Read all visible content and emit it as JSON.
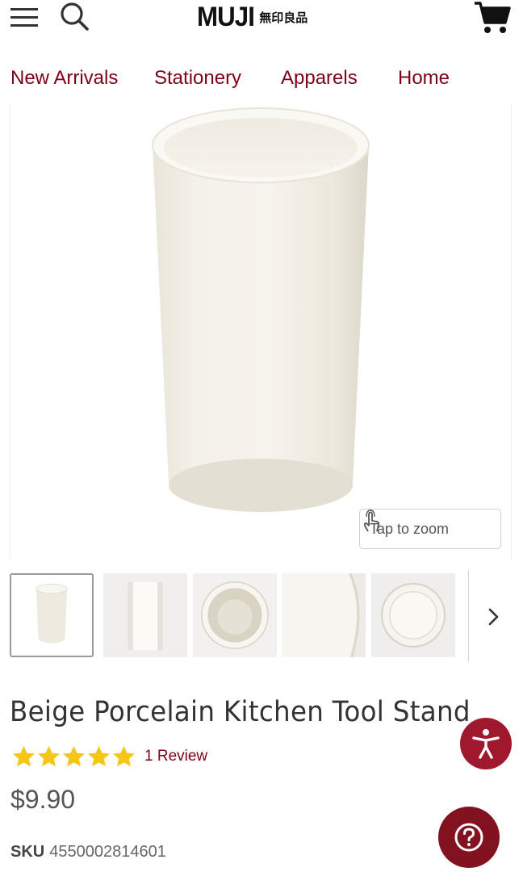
{
  "header": {
    "logo_text": "MUJI",
    "logo_sub": "無印良品",
    "icons": [
      "menu-icon",
      "search-icon",
      "cart-icon"
    ]
  },
  "nav": {
    "items": [
      {
        "label": "New Arrivals"
      },
      {
        "label": "Stationery"
      },
      {
        "label": "Apparels"
      },
      {
        "label": "Home"
      }
    ]
  },
  "gallery": {
    "zoom_label": "Tap to zoom",
    "thumbnail_count_visible": 5
  },
  "product": {
    "title": "Beige Porcelain Kitchen Tool Stand",
    "rating_stars": 5,
    "review_label": "1 Review",
    "price": "$9.90",
    "sku_label": "SKU",
    "sku_value": "4550002814601"
  },
  "colors": {
    "accent": "#7f0019",
    "star": "#f5c518",
    "a11y_button": "#a0182d",
    "help_button": "#831221"
  }
}
